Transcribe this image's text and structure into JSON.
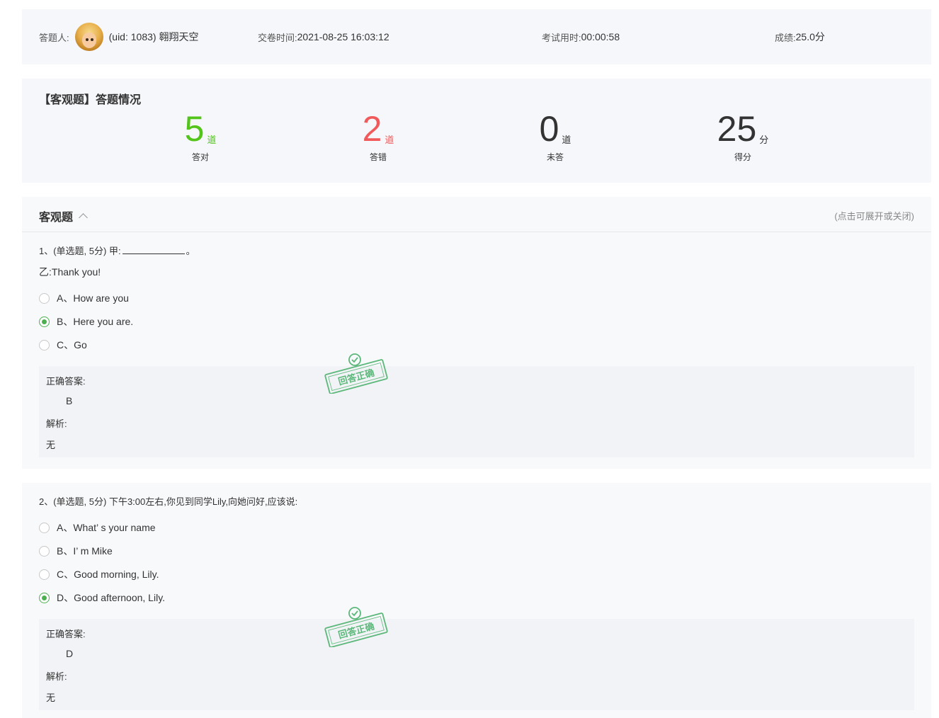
{
  "header": {
    "respondent_label": "答题人:",
    "respondent_name": "(uid: 1083) 翱翔天空",
    "submit_time_label": "交卷时间:",
    "submit_time": "2021-08-25 16:03:12",
    "duration_label": "考试用时:",
    "duration": "00:00:58",
    "score_label": "成绩:",
    "score": "25.0分"
  },
  "summary": {
    "title": "【客观题】答题情况",
    "stats": [
      {
        "value": "5",
        "unit": "道",
        "label": "答对",
        "color": "#52c41a"
      },
      {
        "value": "2",
        "unit": "道",
        "label": "答错",
        "color": "#f05a5a"
      },
      {
        "value": "0",
        "unit": "道",
        "label": "未答",
        "color": "#333333"
      },
      {
        "value": "25",
        "unit": "分",
        "label": "得分",
        "color": "#333333"
      }
    ]
  },
  "section": {
    "title": "客观题",
    "hint": "(点击可展开或关闭)"
  },
  "questions": [
    {
      "stem_prefix": "1、(单选题, 5分) 甲:",
      "stem_suffix": "。",
      "line2": "乙:Thank you!",
      "options": [
        {
          "text": "A、How are you",
          "checked": false
        },
        {
          "text": "B、Here you are.",
          "checked": true
        },
        {
          "text": "C、Go",
          "checked": false
        }
      ],
      "correct_label": "正确答案:",
      "correct_value": "B",
      "analysis_label": "解析:",
      "analysis_value": "无",
      "stamp_text": "回答正确"
    },
    {
      "stem_prefix": "2、(单选题, 5分) 下午3:00左右,你见到同学Lily,向她问好,应该说:",
      "options": [
        {
          "text": "A、What’ s your name",
          "checked": false
        },
        {
          "text": "B、I’ m Mike",
          "checked": false
        },
        {
          "text": "C、Good morning, Lily.",
          "checked": false
        },
        {
          "text": "D、Good afternoon, Lily.",
          "checked": true
        }
      ],
      "correct_label": "正确答案:",
      "correct_value": "D",
      "analysis_label": "解析:",
      "analysis_value": "无",
      "stamp_text": "回答正确"
    }
  ],
  "colors": {
    "accent_green": "#4caf50",
    "stamp_green": "#5cb87a",
    "wrong_red": "#f05a5a"
  }
}
